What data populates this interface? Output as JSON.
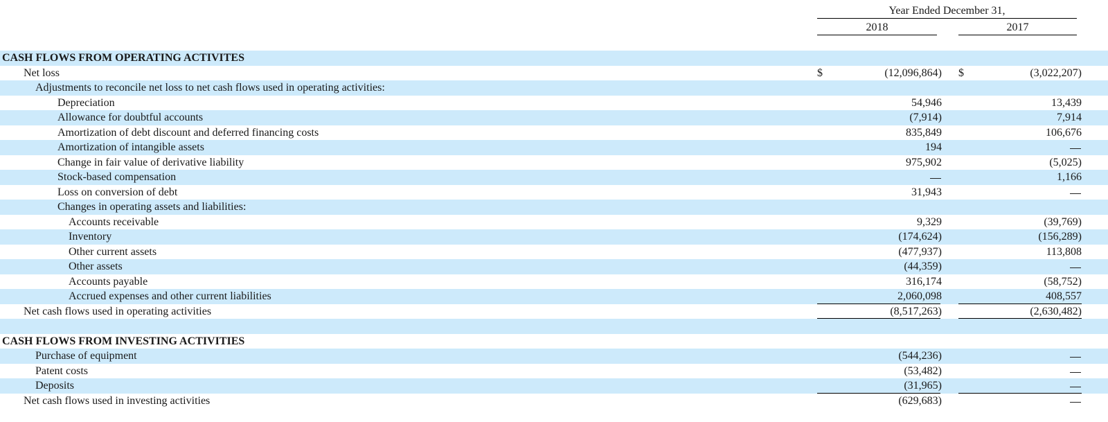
{
  "header": {
    "period_title": "Year Ended December 31,",
    "years": [
      "2018",
      "2017"
    ]
  },
  "rows": [
    {
      "label": "CASH FLOWS FROM OPERATING ACTIVITES",
      "type": "section",
      "shaded": true
    },
    {
      "label": "Net loss",
      "indent": 1,
      "shaded": false,
      "cur": "$",
      "v2018": "(12,096,864)",
      "v2017": "(3,022,207)"
    },
    {
      "label": "Adjustments to reconcile net loss to net cash flows used in operating activities:",
      "indent": 2,
      "shaded": true
    },
    {
      "label": "Depreciation",
      "indent": 3,
      "shaded": false,
      "v2018": "54,946",
      "v2017": "13,439"
    },
    {
      "label": "Allowance for doubtful accounts",
      "indent": 3,
      "shaded": true,
      "v2018": "(7,914)",
      "v2017": "7,914"
    },
    {
      "label": "Amortization of debt discount and deferred financing costs",
      "indent": 3,
      "shaded": false,
      "v2018": "835,849",
      "v2017": "106,676"
    },
    {
      "label": "Amortization of intangible assets",
      "indent": 3,
      "shaded": true,
      "v2018": "194",
      "v2017": "—"
    },
    {
      "label": "Change in fair value of derivative liability",
      "indent": 3,
      "shaded": false,
      "v2018": "975,902",
      "v2017": "(5,025)"
    },
    {
      "label": "Stock-based compensation",
      "indent": 3,
      "shaded": true,
      "v2018": "—",
      "v2017": "1,166"
    },
    {
      "label": "Loss on conversion of debt",
      "indent": 3,
      "shaded": false,
      "v2018": "31,943",
      "v2017": "—"
    },
    {
      "label": "Changes in operating assets and liabilities:",
      "indent": 3,
      "shaded": true
    },
    {
      "label": "Accounts receivable",
      "indent": 4,
      "shaded": false,
      "v2018": "9,329",
      "v2017": "(39,769)"
    },
    {
      "label": "Inventory",
      "indent": 4,
      "shaded": true,
      "v2018": "(174,624)",
      "v2017": "(156,289)"
    },
    {
      "label": "Other current assets",
      "indent": 4,
      "shaded": false,
      "v2018": "(477,937)",
      "v2017": "113,808"
    },
    {
      "label": "Other assets",
      "indent": 4,
      "shaded": true,
      "v2018": "(44,359)",
      "v2017": "—"
    },
    {
      "label": "Accounts payable",
      "indent": 4,
      "shaded": false,
      "v2018": "316,174",
      "v2017": "(58,752)"
    },
    {
      "label": "Accrued expenses and other current liabilities",
      "indent": 4,
      "shaded": true,
      "v2018": "2,060,098",
      "v2017": "408,557"
    },
    {
      "label": "Net cash flows used in operating activities",
      "indent": 1,
      "shaded": false,
      "v2018": "(8,517,263)",
      "v2017": "(2,630,482)",
      "rule_above": true,
      "rule_below": "double"
    },
    {
      "label": "",
      "shaded": true
    },
    {
      "label": "CASH FLOWS FROM INVESTING ACTIVITIES",
      "type": "section",
      "shaded": false
    },
    {
      "label": "Purchase of equipment",
      "indent": 2,
      "shaded": true,
      "v2018": "(544,236)",
      "v2017": "—"
    },
    {
      "label": "Patent costs",
      "indent": 2,
      "shaded": false,
      "v2018": "(53,482)",
      "v2017": "—"
    },
    {
      "label": "Deposits",
      "indent": 2,
      "shaded": true,
      "v2018": "(31,965)",
      "v2017": "—"
    },
    {
      "label": "Net cash flows used in investing activities",
      "indent": 1,
      "shaded": false,
      "v2018": "(629,683)",
      "v2017": "—",
      "rule_above": true
    }
  ]
}
